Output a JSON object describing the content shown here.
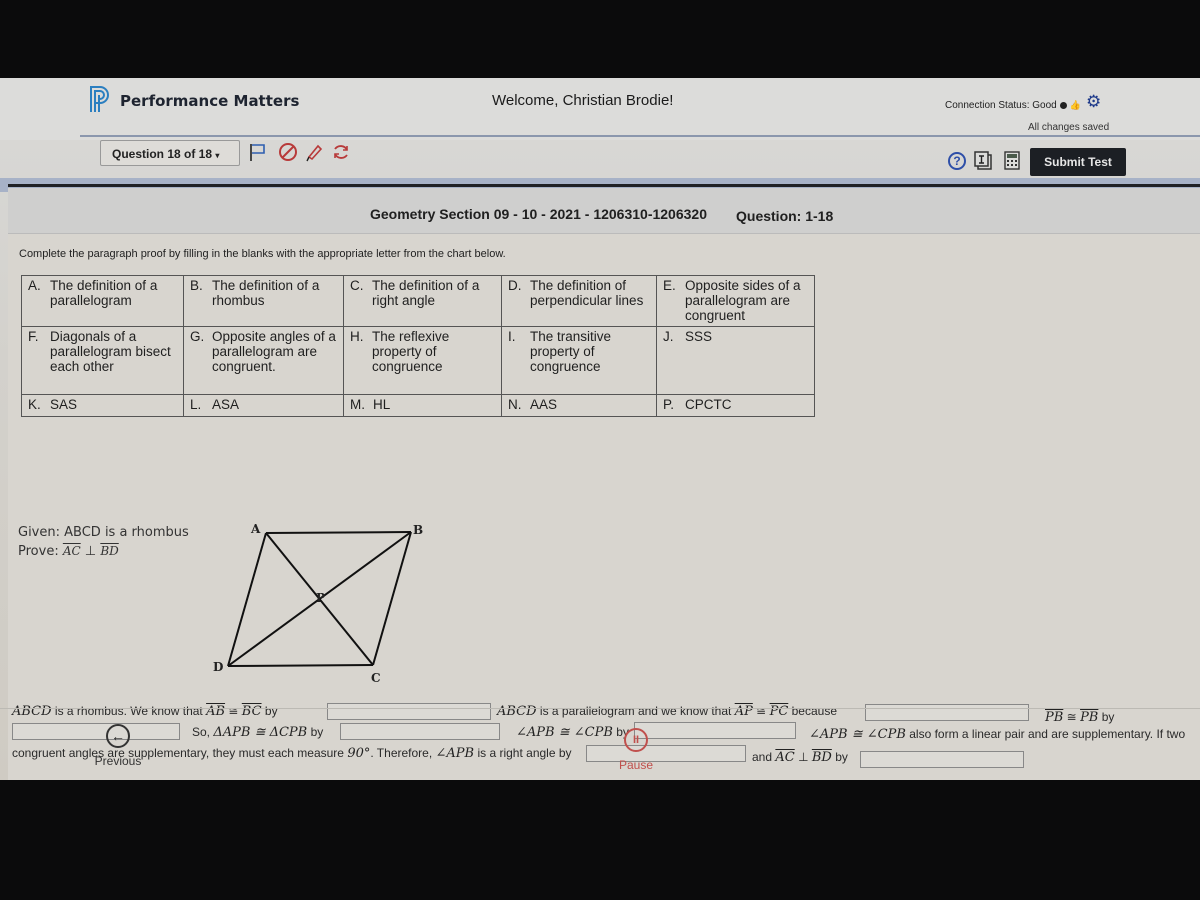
{
  "header": {
    "brand": "Performance Matters",
    "welcome": "Welcome, Christian Brodie!",
    "connection_status": "Connection Status: Good",
    "save_status": "All changes saved"
  },
  "toolbar": {
    "question_selector": "Question 18 of 18",
    "tools": [
      "flag-icon",
      "eliminator-icon",
      "highlighter-icon",
      "reset-icon"
    ],
    "help_icon": "?",
    "submit_label": "Submit Test"
  },
  "test": {
    "section_title": "Geometry Section 09 - 10 - 2021 - 1206310-1206320",
    "question_range": "Question: 1-18",
    "instructions": "Complete the paragraph proof by filling in the blanks with the appropriate letter from the chart below."
  },
  "chart": {
    "rows": [
      [
        {
          "letter": "A.",
          "text": "The definition of a parallelogram"
        },
        {
          "letter": "B.",
          "text": "The definition of a rhombus"
        },
        {
          "letter": "C.",
          "text": "The definition of a right angle"
        },
        {
          "letter": "D.",
          "text": "The definition of perpendicular lines"
        },
        {
          "letter": "E.",
          "text": "Opposite sides of a parallelogram are congruent"
        }
      ],
      [
        {
          "letter": "F.",
          "text": "Diagonals of a parallelogram bisect each other"
        },
        {
          "letter": "G.",
          "text": "Opposite angles of a parallelogram are congruent."
        },
        {
          "letter": "H.",
          "text": "The reflexive property of congruence"
        },
        {
          "letter": "I.",
          "text": "The transitive property of congruence"
        },
        {
          "letter": "J.",
          "text": "SSS"
        }
      ],
      [
        {
          "letter": "K.",
          "text": "SAS"
        },
        {
          "letter": "L.",
          "text": "ASA"
        },
        {
          "letter": "M.",
          "text": "HL"
        },
        {
          "letter": "N.",
          "text": "AAS"
        },
        {
          "letter": "P.",
          "text": "CPCTC"
        }
      ]
    ]
  },
  "problem": {
    "given_label": "Given:",
    "given_text": "ABCD is a rhombus",
    "prove_label": "Prove:",
    "prove_seg1": "AC",
    "prove_symbol": "⊥",
    "prove_seg2": "BD",
    "figure_labels": {
      "a": "A",
      "b": "B",
      "c": "C",
      "d": "D",
      "p": "P"
    }
  },
  "proof": {
    "t1_math": "ABCD",
    "t1": "is a rhombus. We know that",
    "t1_seg1": "AB",
    "t1_cong": "≅",
    "t1_seg2": "BC",
    "t1_by": "by",
    "t2_math": "ABCD",
    "t2": "is a parallelogram and we know that",
    "t2_seg1": "AP",
    "t2_cong": "≅",
    "t2_seg2": "PC",
    "t2_because": "because",
    "t3_seg1": "PB",
    "t3_cong": "≅",
    "t3_seg2": "PB",
    "t3_by": "by",
    "t4": "So,",
    "t4_math": "ΔAPB ≅ ΔCPB",
    "t4_by": "by",
    "t5_math": "∠APB ≅ ∠CPB",
    "t5_by": "by",
    "t6_math": "∠APB ≅ ∠CPB",
    "t6": "also form a linear pair and are supplementary. If two",
    "t7": "congruent angles are supplementary, they must each measure",
    "t7_math": "90°",
    "t7b": ". Therefore,",
    "t7_angle": "∠APB",
    "t7c": "is a right angle by",
    "t8": "and",
    "t8_seg1": "AC",
    "t8_perp": "⊥",
    "t8_seg2": "BD",
    "t8_by": "by",
    "blanks": [
      "",
      "",
      "",
      "",
      "",
      "",
      "",
      ""
    ]
  },
  "navigation": {
    "previous_label": "Previous",
    "pause_label": "Pause"
  }
}
